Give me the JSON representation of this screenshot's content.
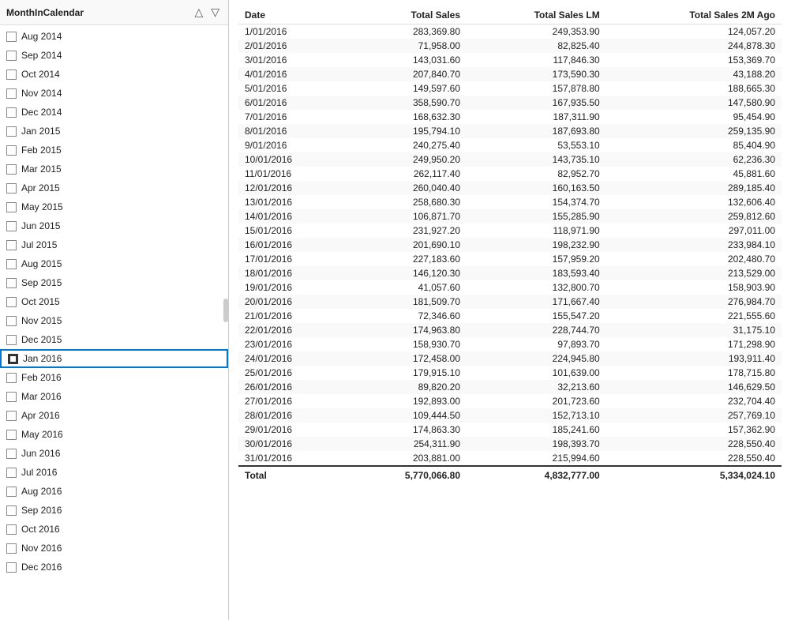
{
  "leftPanel": {
    "title": "MonthInCalendar",
    "items": [
      {
        "label": "Aug 2014",
        "checked": false,
        "selected": false
      },
      {
        "label": "Sep 2014",
        "checked": false,
        "selected": false
      },
      {
        "label": "Oct 2014",
        "checked": false,
        "selected": false
      },
      {
        "label": "Nov 2014",
        "checked": false,
        "selected": false
      },
      {
        "label": "Dec 2014",
        "checked": false,
        "selected": false
      },
      {
        "label": "Jan 2015",
        "checked": false,
        "selected": false
      },
      {
        "label": "Feb 2015",
        "checked": false,
        "selected": false
      },
      {
        "label": "Mar 2015",
        "checked": false,
        "selected": false
      },
      {
        "label": "Apr 2015",
        "checked": false,
        "selected": false
      },
      {
        "label": "May 2015",
        "checked": false,
        "selected": false
      },
      {
        "label": "Jun 2015",
        "checked": false,
        "selected": false
      },
      {
        "label": "Jul 2015",
        "checked": false,
        "selected": false
      },
      {
        "label": "Aug 2015",
        "checked": false,
        "selected": false
      },
      {
        "label": "Sep 2015",
        "checked": false,
        "selected": false
      },
      {
        "label": "Oct 2015",
        "checked": false,
        "selected": false
      },
      {
        "label": "Nov 2015",
        "checked": false,
        "selected": false
      },
      {
        "label": "Dec 2015",
        "checked": false,
        "selected": false
      },
      {
        "label": "Jan 2016",
        "checked": true,
        "selected": true
      },
      {
        "label": "Feb 2016",
        "checked": false,
        "selected": false
      },
      {
        "label": "Mar 2016",
        "checked": false,
        "selected": false
      },
      {
        "label": "Apr 2016",
        "checked": false,
        "selected": false
      },
      {
        "label": "May 2016",
        "checked": false,
        "selected": false
      },
      {
        "label": "Jun 2016",
        "checked": false,
        "selected": false
      },
      {
        "label": "Jul 2016",
        "checked": false,
        "selected": false
      },
      {
        "label": "Aug 2016",
        "checked": false,
        "selected": false
      },
      {
        "label": "Sep 2016",
        "checked": false,
        "selected": false
      },
      {
        "label": "Oct 2016",
        "checked": false,
        "selected": false
      },
      {
        "label": "Nov 2016",
        "checked": false,
        "selected": false
      },
      {
        "label": "Dec 2016",
        "checked": false,
        "selected": false
      }
    ]
  },
  "table": {
    "columns": [
      "Date",
      "Total Sales",
      "Total Sales LM",
      "Total Sales 2M Ago"
    ],
    "rows": [
      [
        "1/01/2016",
        "283,369.80",
        "249,353.90",
        "124,057.20"
      ],
      [
        "2/01/2016",
        "71,958.00",
        "82,825.40",
        "244,878.30"
      ],
      [
        "3/01/2016",
        "143,031.60",
        "117,846.30",
        "153,369.70"
      ],
      [
        "4/01/2016",
        "207,840.70",
        "173,590.30",
        "43,188.20"
      ],
      [
        "5/01/2016",
        "149,597.60",
        "157,878.80",
        "188,665.30"
      ],
      [
        "6/01/2016",
        "358,590.70",
        "167,935.50",
        "147,580.90"
      ],
      [
        "7/01/2016",
        "168,632.30",
        "187,311.90",
        "95,454.90"
      ],
      [
        "8/01/2016",
        "195,794.10",
        "187,693.80",
        "259,135.90"
      ],
      [
        "9/01/2016",
        "240,275.40",
        "53,553.10",
        "85,404.90"
      ],
      [
        "10/01/2016",
        "249,950.20",
        "143,735.10",
        "62,236.30"
      ],
      [
        "11/01/2016",
        "262,117.40",
        "82,952.70",
        "45,881.60"
      ],
      [
        "12/01/2016",
        "260,040.40",
        "160,163.50",
        "289,185.40"
      ],
      [
        "13/01/2016",
        "258,680.30",
        "154,374.70",
        "132,606.40"
      ],
      [
        "14/01/2016",
        "106,871.70",
        "155,285.90",
        "259,812.60"
      ],
      [
        "15/01/2016",
        "231,927.20",
        "118,971.90",
        "297,011.00"
      ],
      [
        "16/01/2016",
        "201,690.10",
        "198,232.90",
        "233,984.10"
      ],
      [
        "17/01/2016",
        "227,183.60",
        "157,959.20",
        "202,480.70"
      ],
      [
        "18/01/2016",
        "146,120.30",
        "183,593.40",
        "213,529.00"
      ],
      [
        "19/01/2016",
        "41,057.60",
        "132,800.70",
        "158,903.90"
      ],
      [
        "20/01/2016",
        "181,509.70",
        "171,667.40",
        "276,984.70"
      ],
      [
        "21/01/2016",
        "72,346.60",
        "155,547.20",
        "221,555.60"
      ],
      [
        "22/01/2016",
        "174,963.80",
        "228,744.70",
        "31,175.10"
      ],
      [
        "23/01/2016",
        "158,930.70",
        "97,893.70",
        "171,298.90"
      ],
      [
        "24/01/2016",
        "172,458.00",
        "224,945.80",
        "193,911.40"
      ],
      [
        "25/01/2016",
        "179,915.10",
        "101,639.00",
        "178,715.80"
      ],
      [
        "26/01/2016",
        "89,820.20",
        "32,213.60",
        "146,629.50"
      ],
      [
        "27/01/2016",
        "192,893.00",
        "201,723.60",
        "232,704.40"
      ],
      [
        "28/01/2016",
        "109,444.50",
        "152,713.10",
        "257,769.10"
      ],
      [
        "29/01/2016",
        "174,863.30",
        "185,241.60",
        "157,362.90"
      ],
      [
        "30/01/2016",
        "254,311.90",
        "198,393.70",
        "228,550.40"
      ],
      [
        "31/01/2016",
        "203,881.00",
        "215,994.60",
        "228,550.40"
      ]
    ],
    "total": [
      "Total",
      "5,770,066.80",
      "4,832,777.00",
      "5,334,024.10"
    ]
  }
}
